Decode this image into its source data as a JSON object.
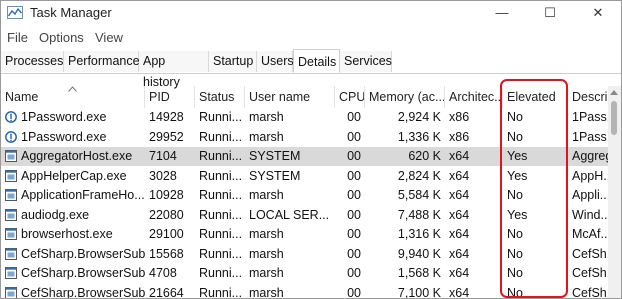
{
  "window": {
    "title": "Task Manager",
    "controls": {
      "minimize": "—",
      "maximize": "☐",
      "close": "✕"
    }
  },
  "menu": [
    "File",
    "Options",
    "View"
  ],
  "tabs": [
    {
      "label": "Processes",
      "active": false
    },
    {
      "label": "Performance",
      "active": false
    },
    {
      "label": "App history",
      "active": false
    },
    {
      "label": "Startup",
      "active": false
    },
    {
      "label": "Users",
      "active": false
    },
    {
      "label": "Details",
      "active": true
    },
    {
      "label": "Services",
      "active": false
    }
  ],
  "columns": [
    "Name",
    "PID",
    "Status",
    "User name",
    "CPU",
    "Memory (ac...",
    "Architec...",
    "Elevated",
    "Descri"
  ],
  "sort": {
    "column": "Name",
    "direction": "ascending"
  },
  "highlight": {
    "column": "Elevated",
    "color": "#e0141b"
  },
  "rows": [
    {
      "icon": "info-icon",
      "name": "1Password.exe",
      "pid": "14928",
      "status": "Runni...",
      "user": "marsh",
      "cpu": "00",
      "memory": "2,924 K",
      "arch": "x86",
      "elevated": "No",
      "desc": "1Pass..."
    },
    {
      "icon": "info-icon",
      "name": "1Password.exe",
      "pid": "29952",
      "status": "Runni...",
      "user": "marsh",
      "cpu": "00",
      "memory": "1,336 K",
      "arch": "x86",
      "elevated": "No",
      "desc": "1Pass..."
    },
    {
      "icon": "process-icon",
      "name": "AggregatorHost.exe",
      "pid": "7104",
      "status": "Runni...",
      "user": "SYSTEM",
      "cpu": "00",
      "memory": "620 K",
      "arch": "x64",
      "elevated": "Yes",
      "desc": "Aggreg",
      "selected": true
    },
    {
      "icon": "process-icon",
      "name": "AppHelperCap.exe",
      "pid": "3028",
      "status": "Runni...",
      "user": "SYSTEM",
      "cpu": "00",
      "memory": "2,824 K",
      "arch": "x64",
      "elevated": "Yes",
      "desc": "AppH..."
    },
    {
      "icon": "process-icon",
      "name": "ApplicationFrameHo...",
      "pid": "10928",
      "status": "Runni...",
      "user": "marsh",
      "cpu": "00",
      "memory": "5,584 K",
      "arch": "x64",
      "elevated": "No",
      "desc": "Appli..."
    },
    {
      "icon": "process-icon",
      "name": "audiodg.exe",
      "pid": "22080",
      "status": "Runni...",
      "user": "LOCAL SER...",
      "cpu": "00",
      "memory": "7,488 K",
      "arch": "x64",
      "elevated": "Yes",
      "desc": "Wind..."
    },
    {
      "icon": "process-icon",
      "name": "browserhost.exe",
      "pid": "29100",
      "status": "Runni...",
      "user": "marsh",
      "cpu": "00",
      "memory": "1,316 K",
      "arch": "x64",
      "elevated": "No",
      "desc": "McAf..."
    },
    {
      "icon": "process-icon",
      "name": "CefSharp.BrowserSub...",
      "pid": "15568",
      "status": "Runni...",
      "user": "marsh",
      "cpu": "00",
      "memory": "9,940 K",
      "arch": "x64",
      "elevated": "No",
      "desc": "CefSh..."
    },
    {
      "icon": "process-icon",
      "name": "CefSharp.BrowserSub...",
      "pid": "4708",
      "status": "Runni...",
      "user": "marsh",
      "cpu": "00",
      "memory": "1,568 K",
      "arch": "x64",
      "elevated": "No",
      "desc": "CefSh..."
    },
    {
      "icon": "process-icon",
      "name": "CefSharp.BrowserSub...",
      "pid": "21664",
      "status": "Runni...",
      "user": "marsh",
      "cpu": "00",
      "memory": "7,100 K",
      "arch": "x64",
      "elevated": "No",
      "desc": "CefSh..."
    }
  ]
}
